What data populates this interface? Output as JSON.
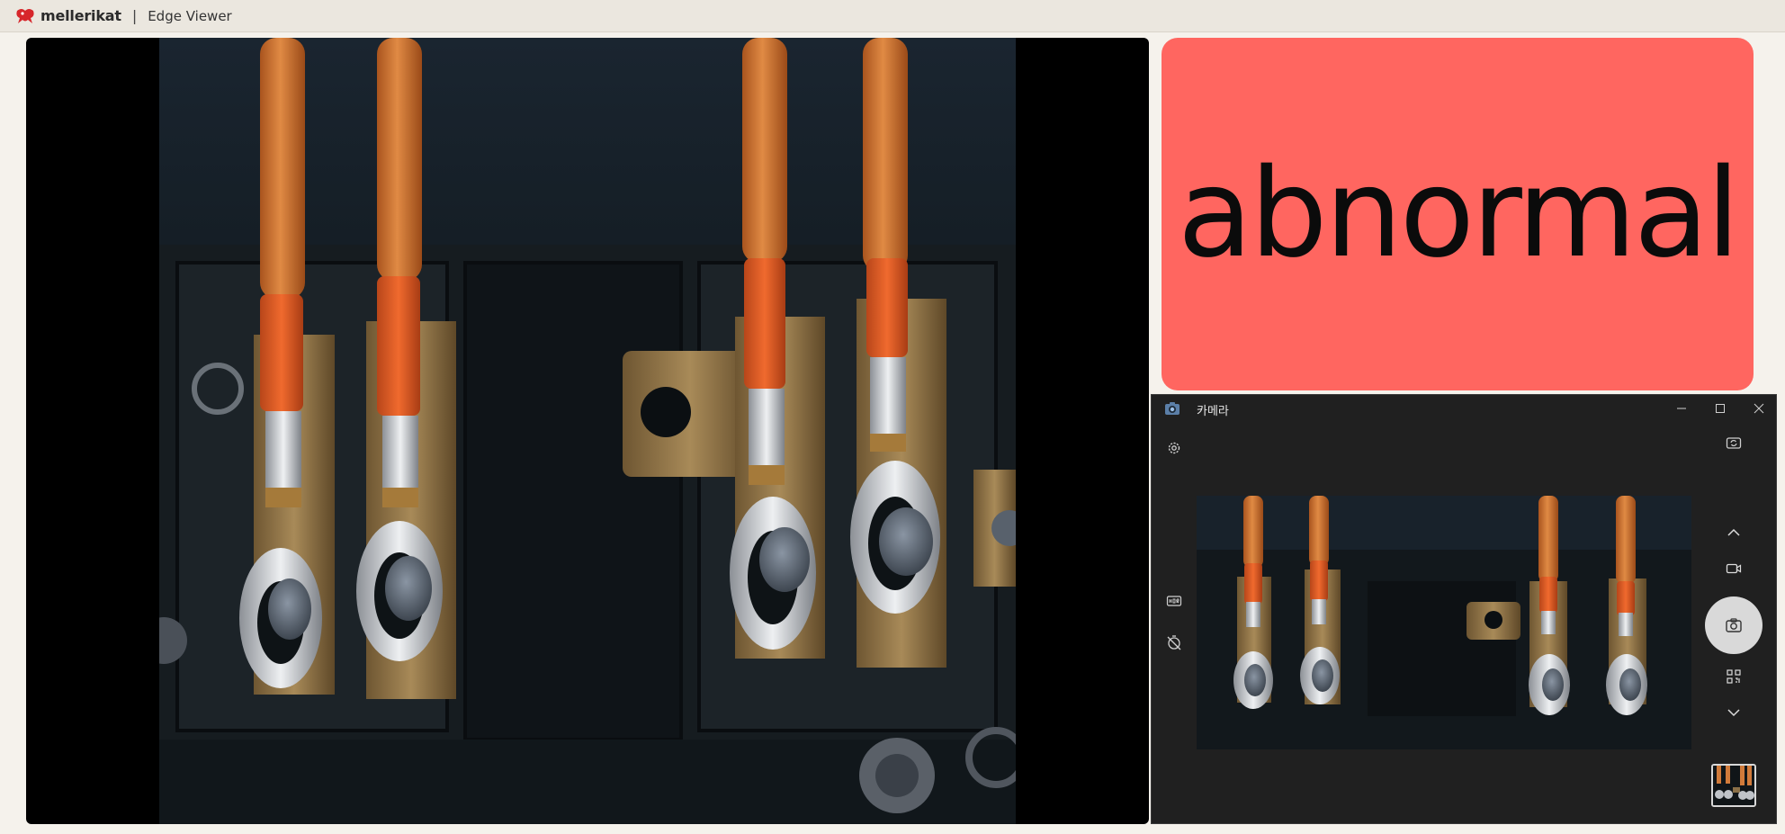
{
  "header": {
    "brand": "mellerikat",
    "separator": "|",
    "title": "Edge Viewer"
  },
  "status": {
    "label": "abnormal",
    "color": "#ff6660"
  },
  "camera_window": {
    "title": "카메라",
    "icons": {
      "app": "camera-app-icon",
      "minimize": "minimize-icon",
      "maximize": "maximize-icon",
      "close": "close-icon",
      "settings": "gear-icon",
      "switch_camera": "switch-camera-icon",
      "hdr": "hdr-icon",
      "timer_off": "timer-off-icon",
      "mode_up": "chevron-up-icon",
      "video_mode": "video-icon",
      "photo": "camera-icon",
      "barcode": "qr-code-icon",
      "mode_down": "chevron-down-icon"
    }
  },
  "colors": {
    "brand_red": "#d7262b",
    "accent": "#ff6660",
    "camera_bg": "#202020"
  }
}
